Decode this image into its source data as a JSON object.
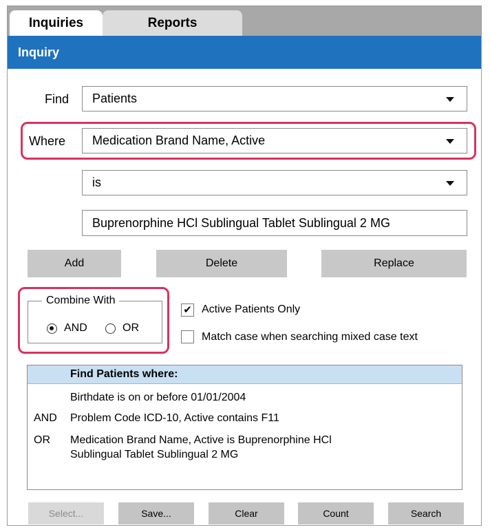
{
  "tabs": {
    "inquiries": "Inquiries",
    "reports": "Reports"
  },
  "section": {
    "title": "Inquiry"
  },
  "find": {
    "label": "Find",
    "value": "Patients"
  },
  "where": {
    "label": "Where",
    "value": "Medication Brand Name, Active"
  },
  "operator": {
    "value": "is"
  },
  "criteria": {
    "value": "Buprenorphine HCl Sublingual Tablet Sublingual 2 MG"
  },
  "actions": {
    "add": "Add",
    "delete": "Delete",
    "replace": "Replace"
  },
  "combine": {
    "title": "Combine With",
    "and": "AND",
    "or": "OR",
    "selected": "AND"
  },
  "options": {
    "active_only": {
      "label": "Active Patients Only",
      "checked": true
    },
    "match_case": {
      "label": "Match case when searching mixed case text",
      "checked": false
    }
  },
  "results": {
    "header": "Find Patients where:",
    "rows": [
      {
        "op": "",
        "text": "Birthdate is on or before 01/01/2004"
      },
      {
        "op": "AND",
        "text": "Problem Code ICD-10, Active contains F11"
      },
      {
        "op": "OR",
        "text": "Medication Brand Name, Active is Buprenorphine HCl",
        "text2": "Sublingual Tablet Sublingual 2 MG"
      }
    ]
  },
  "bottom": {
    "select": "Select...",
    "save": "Save...",
    "clear": "Clear",
    "count": "Count",
    "search": "Search"
  },
  "colors": {
    "header_blue": "#1f72be",
    "highlight": "#d6335f",
    "results_header": "#c9e0f3"
  }
}
